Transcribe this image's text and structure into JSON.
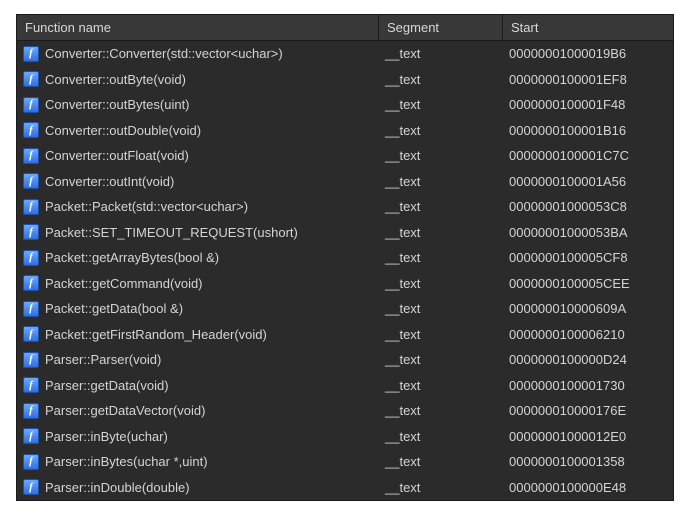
{
  "columns": {
    "name": "Function name",
    "segment": "Segment",
    "start": "Start"
  },
  "icon_glyph": "f",
  "rows": [
    {
      "name": "Converter::Converter(std::vector<uchar>)",
      "segment": "__text",
      "start": "00000001000019B6"
    },
    {
      "name": "Converter::outByte(void)",
      "segment": "__text",
      "start": "0000000100001EF8"
    },
    {
      "name": "Converter::outBytes(uint)",
      "segment": "__text",
      "start": "0000000100001F48"
    },
    {
      "name": "Converter::outDouble(void)",
      "segment": "__text",
      "start": "0000000100001B16"
    },
    {
      "name": "Converter::outFloat(void)",
      "segment": "__text",
      "start": "0000000100001C7C"
    },
    {
      "name": "Converter::outInt(void)",
      "segment": "__text",
      "start": "0000000100001A56"
    },
    {
      "name": "Packet::Packet(std::vector<uchar>)",
      "segment": "__text",
      "start": "00000001000053C8"
    },
    {
      "name": "Packet::SET_TIMEOUT_REQUEST(ushort)",
      "segment": "__text",
      "start": "00000001000053BA"
    },
    {
      "name": "Packet::getArrayBytes(bool &)",
      "segment": "__text",
      "start": "0000000100005CF8"
    },
    {
      "name": "Packet::getCommand(void)",
      "segment": "__text",
      "start": "0000000100005CEE"
    },
    {
      "name": "Packet::getData(bool &)",
      "segment": "__text",
      "start": "000000010000609A"
    },
    {
      "name": "Packet::getFirstRandom_Header(void)",
      "segment": "__text",
      "start": "0000000100006210"
    },
    {
      "name": "Parser::Parser(void)",
      "segment": "__text",
      "start": "0000000100000D24"
    },
    {
      "name": "Parser::getData(void)",
      "segment": "__text",
      "start": "0000000100001730"
    },
    {
      "name": "Parser::getDataVector(void)",
      "segment": "__text",
      "start": "000000010000176E"
    },
    {
      "name": "Parser::inByte(uchar)",
      "segment": "__text",
      "start": "00000001000012E0"
    },
    {
      "name": "Parser::inBytes(uchar *,uint)",
      "segment": "__text",
      "start": "0000000100001358"
    },
    {
      "name": "Parser::inDouble(double)",
      "segment": "__text",
      "start": "0000000100000E48"
    }
  ]
}
